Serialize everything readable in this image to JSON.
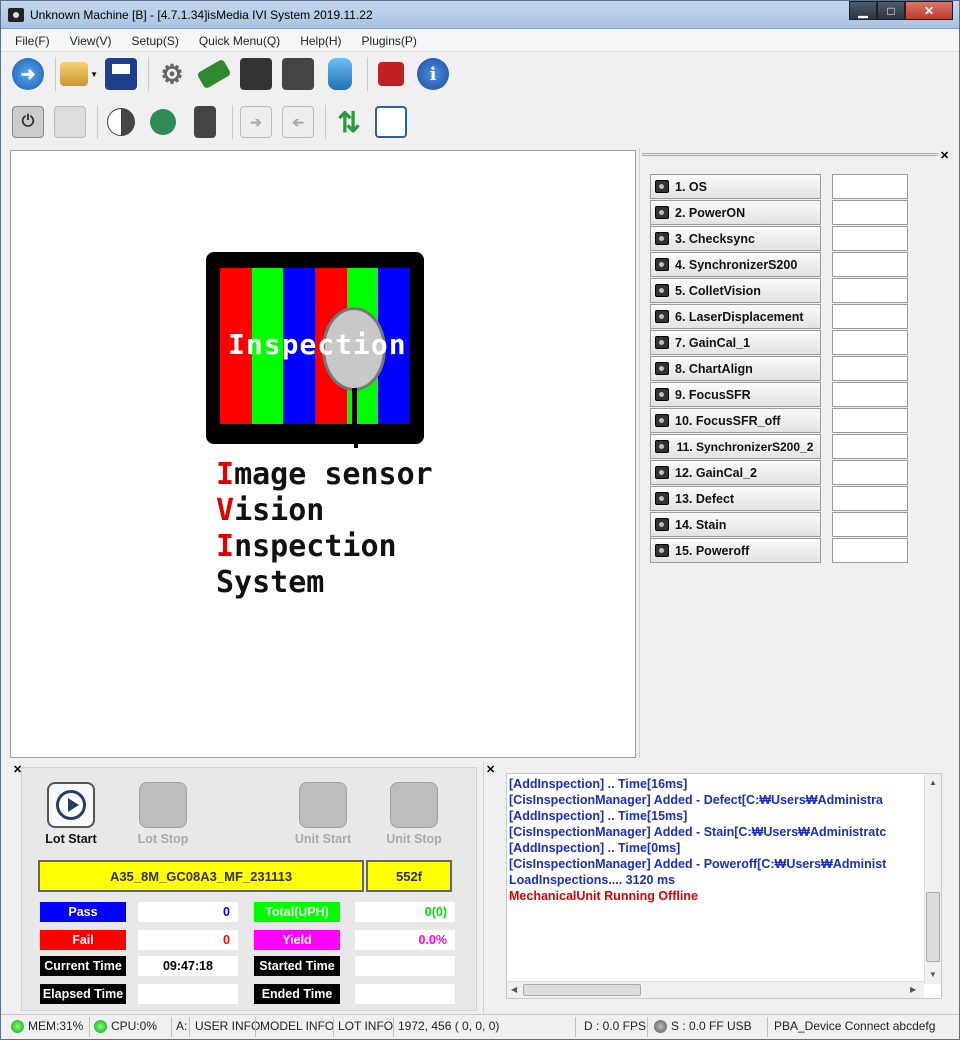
{
  "window": {
    "title": "Unknown Machine [B] - [4.7.1.34]isMedia IVI System 2019.11.22"
  },
  "menu": [
    "File(F)",
    "View(V)",
    "Setup(S)",
    "Quick Menu(Q)",
    "Help(H)",
    "Plugins(P)"
  ],
  "logo": {
    "banner": "Inspection",
    "lines": [
      {
        "initial": "I",
        "rest": "mage sensor"
      },
      {
        "initial": "V",
        "rest": "ision"
      },
      {
        "initial": "I",
        "rest": "nspection"
      },
      {
        "initial": "",
        "rest": "System"
      }
    ],
    "bar_colors": [
      "#ff0000",
      "#00ff00",
      "#0000ff",
      "#ff0000",
      "#00ff00",
      "#0000ff"
    ]
  },
  "inspections": [
    "1. OS",
    "2. PowerON",
    "3. Checksync",
    "4. SynchronizerS200",
    "5. ColletVision",
    "6. LaserDisplacement",
    "7. GainCal_1",
    "8. ChartAlign",
    "9. FocusSFR",
    "10. FocusSFR_off",
    "11. SynchronizerS200_2",
    "12. GainCal_2",
    "13. Defect",
    "14. Stain",
    "15. Poweroff"
  ],
  "controls": {
    "lot_start": "Lot Start",
    "lot_stop": "Lot Stop",
    "unit_start": "Unit Start",
    "unit_stop": "Unit Stop",
    "lot_name": "A35_8M_GC08A3_MF_231113",
    "lot_count": "552f"
  },
  "stats": {
    "pass_label": "Pass",
    "pass_value": "0",
    "fail_label": "Fail",
    "fail_value": "0",
    "total_label": "Total(UPH)",
    "total_value": "0(0)",
    "yield_label": "Yield",
    "yield_value": "0.0%",
    "current_time_label": "Current Time",
    "current_time_value": "09:47:18",
    "started_time_label": "Started Time",
    "started_time_value": "",
    "elapsed_time_label": "Elapsed Time",
    "elapsed_time_value": "",
    "ended_time_label": "Ended Time",
    "ended_time_value": ""
  },
  "log": [
    {
      "text": "[AddInspection]  .. Time[16ms]",
      "type": "info"
    },
    {
      "text": "[CisInspectionManager] Added - Defect[C:\\Users\\Administra",
      "type": "info"
    },
    {
      "text": "[AddInspection]  .. Time[15ms]",
      "type": "info"
    },
    {
      "text": "[CisInspectionManager] Added - Stain[C:\\Users\\Administratc",
      "type": "info"
    },
    {
      "text": "[AddInspection]  .. Time[0ms]",
      "type": "info"
    },
    {
      "text": "[CisInspectionManager] Added - Poweroff[C:\\Users\\Administ",
      "type": "info"
    },
    {
      "text": "LoadInspections.... 3120 ms",
      "type": "info"
    },
    {
      "text": "MechanicalUnit Running Offline",
      "type": "error"
    }
  ],
  "status": {
    "mem": "MEM:31%",
    "cpu": "CPU:0%",
    "a": "A:",
    "user_info": "USER INFO",
    "model_info": "MODEL INFO",
    "lot_info": "LOT INFO",
    "coords": "1972,  456 (  0,   0,   0)",
    "fps": "D : 0.0 FPS",
    "usb": "S : 0.0 FF  USB",
    "device": "PBA_Device Connect abcdefg"
  },
  "colors": {
    "pass": "#0000ff",
    "fail": "#ff0000",
    "total": "#00ff00",
    "yield": "#ff00ff",
    "time_label": "#000000",
    "log_info": "#1a2fc0",
    "log_error": "#e00000"
  }
}
